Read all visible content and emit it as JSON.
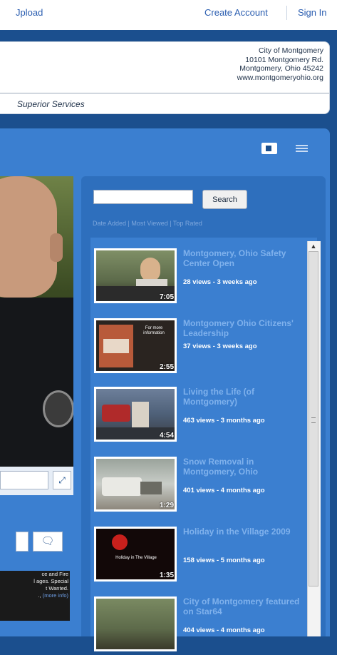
{
  "topbar": {
    "upload_label": "Jpload",
    "create_account_label": "Create Account",
    "sign_in_label": "Sign In"
  },
  "header": {
    "address": [
      "City of Montgomery",
      "10101 Montgomery Rd.",
      "Montgomery, Ohio 45242",
      "www.montgomeryohio.org"
    ],
    "tagline": "Superior Services"
  },
  "player": {
    "fullscreen_icon": "fullscreen-icon",
    "comment_icon": "speech-bubble-icon",
    "description_lines": "ce and Fire\nl ages. Special\nt Wanted.",
    "description_more": "(more info)"
  },
  "search": {
    "placeholder": "",
    "button_label": "Search",
    "sort_label": "Date Added | Most Viewed | Top Rated"
  },
  "videos": [
    {
      "title": "Montgomery, Ohio Safety Center Open",
      "meta": "28 views - 3 weeks ago",
      "duration": "7:05"
    },
    {
      "title": "Montgomery Ohio Citizens' Leadership",
      "meta": "37 views - 3 weeks ago",
      "duration": "2:55"
    },
    {
      "title": "Living the Life (of Montgomery)",
      "meta": "463 views - 3 months ago",
      "duration": "4:54"
    },
    {
      "title": "Snow Removal in Montgomery, Ohio",
      "meta": "401 views - 4 months ago",
      "duration": "1:29"
    },
    {
      "title": "Holiday in the Village 2009",
      "meta": "158 views - 5 months ago",
      "duration": "1:35"
    },
    {
      "title": "City of Montgomery featured on Star64",
      "meta": "404 views - 4 months ago",
      "duration": ""
    }
  ],
  "thumb_text": {
    "t2_lines": "For more\ninformation",
    "t5_caption": "Holiday in The Village"
  },
  "colors": {
    "page_bg": "#1b4f8e",
    "panel": "#3b7fd0",
    "title_link": "#7fb1ec",
    "top_link": "#2a5db0"
  }
}
